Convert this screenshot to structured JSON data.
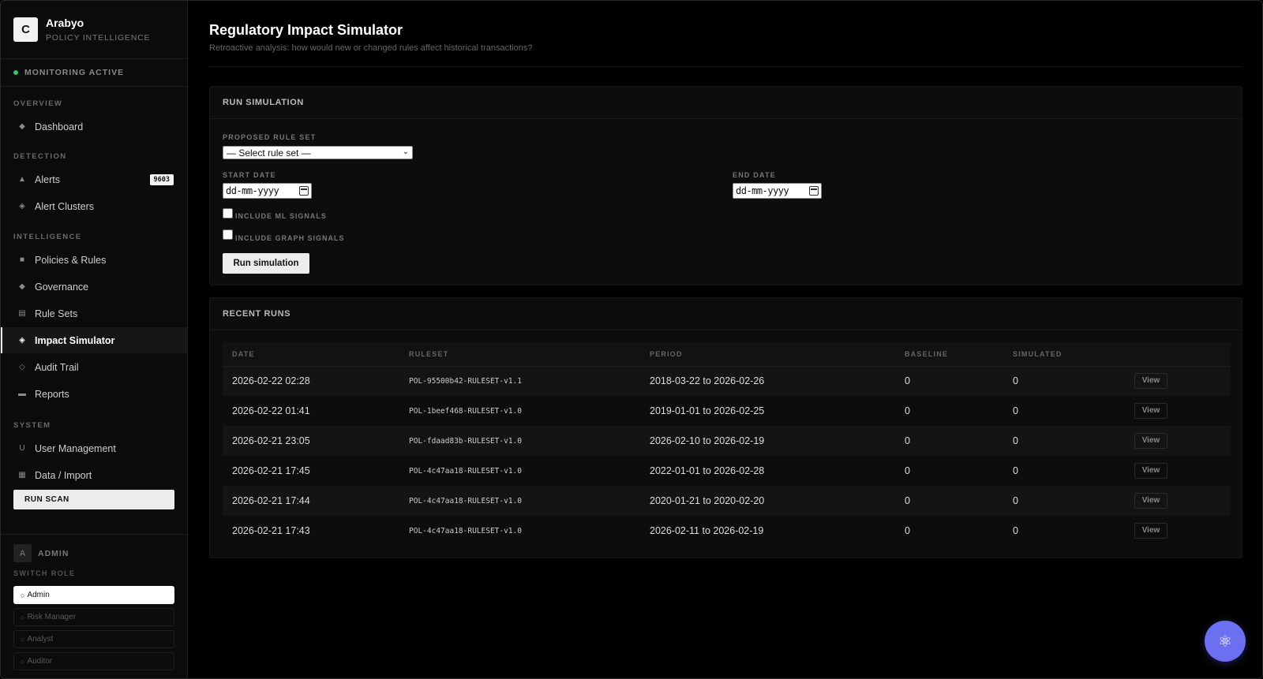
{
  "brand": {
    "logo_letter": "C",
    "name": "Arabyo",
    "subtitle": "POLICY INTELLIGENCE"
  },
  "status": {
    "label": "MONITORING ACTIVE",
    "color": "#3fbf6a"
  },
  "sidebar": {
    "sections": [
      "OVERVIEW",
      "DETECTION",
      "INTELLIGENCE",
      "SYSTEM"
    ],
    "items": [
      {
        "label": "Dashboard",
        "icon": "diamond-icon"
      },
      {
        "label": "Alerts",
        "icon": "triangle-icon",
        "badge": "9603"
      },
      {
        "label": "Alert Clusters",
        "icon": "cluster-diamond-icon"
      },
      {
        "label": "Policies & Rules",
        "icon": "square-icon"
      },
      {
        "label": "Governance",
        "icon": "diamond-icon"
      },
      {
        "label": "Rule Sets",
        "icon": "list-icon"
      },
      {
        "label": "Impact Simulator",
        "icon": "cluster-diamond-icon",
        "active": true
      },
      {
        "label": "Audit Trail",
        "icon": "diamond-outline-icon"
      },
      {
        "label": "Reports",
        "icon": "rectangle-icon"
      },
      {
        "label": "User Management",
        "icon": "u-icon"
      },
      {
        "label": "Data / Import",
        "icon": "grid-square-icon"
      }
    ],
    "run_scan_label": "RUN SCAN"
  },
  "user": {
    "avatar_letter": "A",
    "name": "ADMIN",
    "switch_role_label": "SWITCH ROLE",
    "roles": [
      "Admin",
      "Risk Manager",
      "Analyst",
      "Auditor"
    ],
    "selected_role": "Admin"
  },
  "page": {
    "title": "Regulatory Impact Simulator",
    "subtitle": "Retroactive analysis: how would new or changed rules affect historical transactions?"
  },
  "simulation": {
    "heading": "RUN SIMULATION",
    "rule_set_label": "PROPOSED RULE SET",
    "rule_set_value": "— Select rule set —",
    "start_date_label": "START DATE",
    "start_date_placeholder": "dd-mm-yyyy",
    "end_date_label": "END DATE",
    "end_date_placeholder": "dd-mm-yyyy",
    "ml_signals_label": "INCLUDE ML SIGNALS",
    "graph_signals_label": "INCLUDE GRAPH SIGNALS",
    "run_button_label": "Run simulation"
  },
  "recent_runs": {
    "heading": "RECENT RUNS",
    "columns": [
      "DATE",
      "RULESET",
      "PERIOD",
      "BASELINE",
      "SIMULATED"
    ],
    "view_label": "View",
    "rows": [
      {
        "date": "2026-02-22 02:28",
        "ruleset": "POL-95500b42-RULESET-v1.1",
        "period": "2018-03-22 to 2026-02-26",
        "baseline": "0",
        "simulated": "0"
      },
      {
        "date": "2026-02-22 01:41",
        "ruleset": "POL-1beef468-RULESET-v1.0",
        "period": "2019-01-01 to 2026-02-25",
        "baseline": "0",
        "simulated": "0"
      },
      {
        "date": "2026-02-21 23:05",
        "ruleset": "POL-fdaad83b-RULESET-v1.0",
        "period": "2026-02-10 to 2026-02-19",
        "baseline": "0",
        "simulated": "0"
      },
      {
        "date": "2026-02-21 17:45",
        "ruleset": "POL-4c47aa18-RULESET-v1.0",
        "period": "2022-01-01 to 2026-02-28",
        "baseline": "0",
        "simulated": "0"
      },
      {
        "date": "2026-02-21 17:44",
        "ruleset": "POL-4c47aa18-RULESET-v1.0",
        "period": "2020-01-21 to 2020-02-20",
        "baseline": "0",
        "simulated": "0"
      },
      {
        "date": "2026-02-21 17:43",
        "ruleset": "POL-4c47aa18-RULESET-v1.0",
        "period": "2026-02-11 to 2026-02-19",
        "baseline": "0",
        "simulated": "0"
      }
    ]
  },
  "fab": {
    "icon": "atom-icon",
    "color": "#6b6ff0"
  }
}
